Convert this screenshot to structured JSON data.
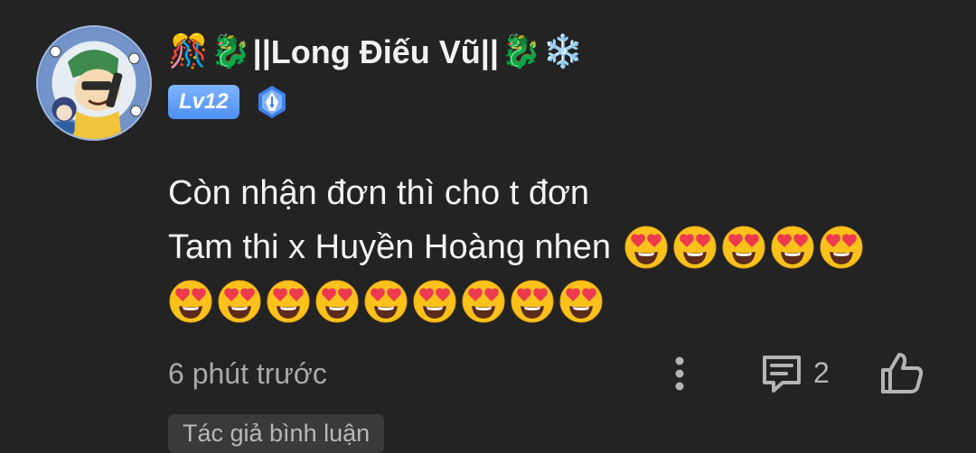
{
  "comment": {
    "username": "||Long Điếu Vũ||",
    "name_prefix_emoji": [
      "🎊",
      "🐉"
    ],
    "name_suffix_emoji": [
      "🐉",
      "❄️"
    ],
    "level_badge": "Lv12",
    "badge_icon": "pen-nib-icon",
    "text_lines": [
      "Còn nhận đơn thì cho t đơn",
      "Tam thi x Huyền Hoàng nhen"
    ],
    "emoji_line2_count": 5,
    "emoji_line3_count": 9,
    "emoji_name": "smiling-face-with-heart-eyes",
    "timestamp": "6 phút trước",
    "reply_count": "2",
    "author_tag": "Tác giả bình luận"
  },
  "colors": {
    "background": "#232323",
    "text": "#f2f2f2",
    "muted": "#a9a9a9",
    "level_badge": "#5b9bf6",
    "tag_bg": "#3a3a3a"
  }
}
